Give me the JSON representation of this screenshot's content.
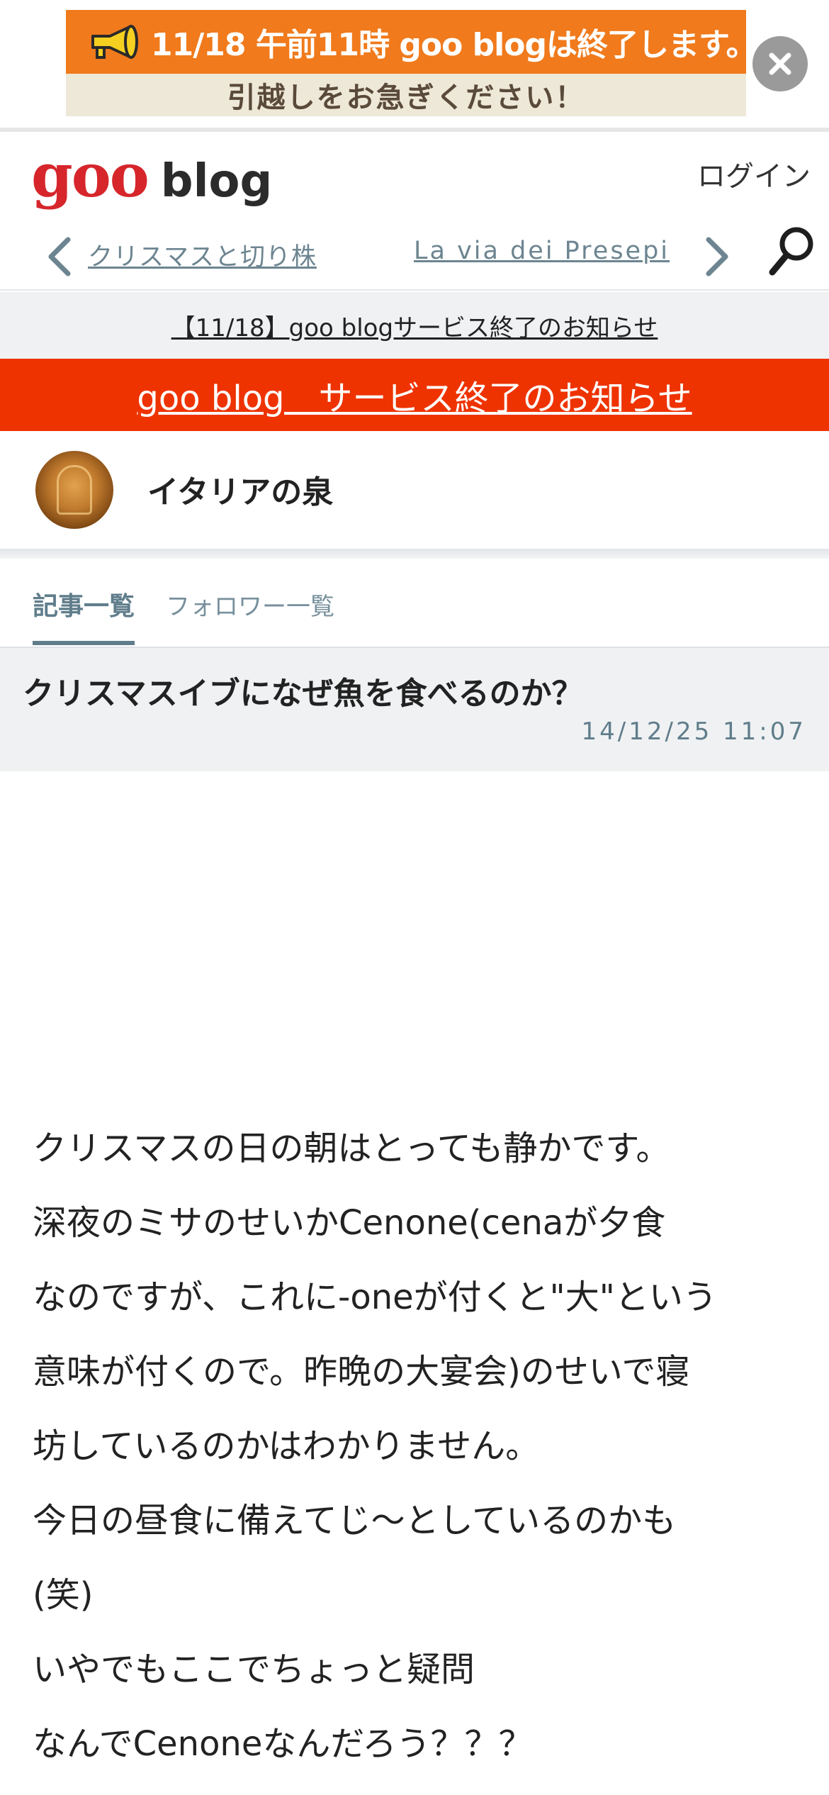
{
  "banner": {
    "line1": "11/18 午前11時 goo blogは終了します。",
    "line2": "引越しをお急ぎください！",
    "megaphone_icon": "megaphone-icon",
    "close_icon": "close-icon",
    "colors": {
      "top": "#f07a1c",
      "bottom": "#eee8d8"
    }
  },
  "header": {
    "logo_goo": "goo",
    "logo_blog": "blog",
    "login": "ログイン"
  },
  "post_nav": {
    "prev": "クリスマスと切り株",
    "next": "La via dei Presepi",
    "prev_icon": "chevron-left-icon",
    "next_icon": "chevron-right-icon",
    "search_icon": "search-icon"
  },
  "notice": {
    "text": "【11/18】goo blogサービス終了のお知らせ"
  },
  "red_notice": {
    "text": "goo blog　サービス終了のお知らせ",
    "color": "#ee3300"
  },
  "blog": {
    "name": "イタリアの泉"
  },
  "tabs": {
    "articles": "記事一覧",
    "followers": "フォロワー一覧"
  },
  "article": {
    "title": "クリスマスイブになぜ魚を食べるのか？",
    "date": "14/12/25 11:07",
    "lines": [
      "クリスマスの日の朝はとっても静かです。",
      "深夜のミサのせいかCenone(cenaが夕食",
      "なのですが、これに-oneが付くと\"大\"という",
      "意味が付くので。昨晩の大宴会)のせいで寝",
      "坊しているのかはわかりません。",
      "今日の昼食に備えてじ～としているのかも",
      "(笑)",
      "いやでもここでちょっと疑問",
      "なんでCenoneなんだろう？？？"
    ]
  }
}
